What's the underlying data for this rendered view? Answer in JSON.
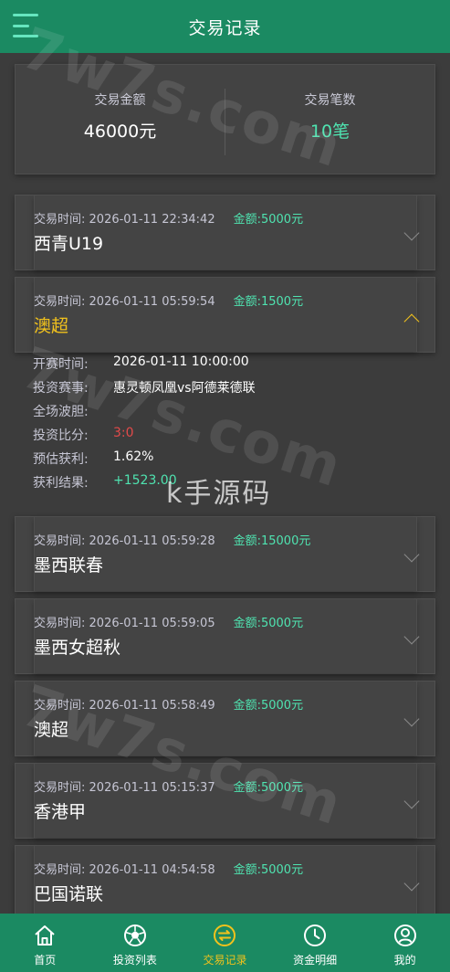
{
  "header": {
    "title": "交易记录",
    "menu_icon": "hamburger-icon"
  },
  "summary": {
    "amount_label": "交易金额",
    "amount_value": "46000元",
    "count_label": "交易笔数",
    "count_value": "10笔"
  },
  "records": [
    {
      "time_label": "交易时间:",
      "time": "2026-01-11 22:34:42",
      "amount": "金额:5000元",
      "name": "西青U19"
    },
    {
      "time_label": "交易时间:",
      "time": "2026-01-11 05:59:54",
      "amount": "金额:1500元",
      "name": "澳超"
    },
    {
      "time_label": "交易时间:",
      "time": "2026-01-11 05:59:28",
      "amount": "金额:15000元",
      "name": "墨西联春"
    },
    {
      "time_label": "交易时间:",
      "time": "2026-01-11 05:59:05",
      "amount": "金额:5000元",
      "name": "墨西女超秋"
    },
    {
      "time_label": "交易时间:",
      "time": "2026-01-11 05:58:49",
      "amount": "金额:5000元",
      "name": "澳超"
    },
    {
      "time_label": "交易时间:",
      "time": "2026-01-11 05:15:37",
      "amount": "金额:5000元",
      "name": "香港甲"
    },
    {
      "time_label": "交易时间:",
      "time": "2026-01-11 04:54:58",
      "amount": "金额:5000元",
      "name": "巴国诺联"
    }
  ],
  "detail": {
    "start_label": "开赛时间:",
    "start_value": "2026-01-11 10:00:00",
    "match_label": "投资赛事:",
    "match_value": "惠灵顿凤凰vs阿德莱德联",
    "full_label": "全场波胆:",
    "full_value": "",
    "score_label": "投资比分:",
    "score_value": "3:0",
    "profit_label": "预估获利:",
    "profit_value": "1.62%",
    "result_label": "获利结果:",
    "result_value": "+1523.00"
  },
  "tabs": [
    {
      "label": "首页",
      "icon": "home-icon"
    },
    {
      "label": "投资列表",
      "icon": "football-icon"
    },
    {
      "label": "交易记录",
      "icon": "exchange-icon"
    },
    {
      "label": "资金明细",
      "icon": "clock-icon"
    },
    {
      "label": "我的",
      "icon": "user-icon"
    }
  ],
  "watermarks": {
    "brand": "7w7s.com",
    "ks": "k手源码"
  },
  "colors": {
    "primary": "#1b8a62",
    "accent_green": "#4fe3b0",
    "accent_yellow": "#f2c21c",
    "background": "#3c3c3c",
    "red": "#e34a4a"
  }
}
